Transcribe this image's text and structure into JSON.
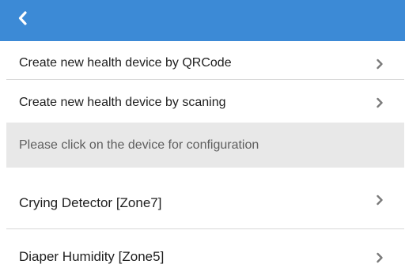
{
  "header": {
    "back_icon": "chevron-left-icon",
    "accent_color": "#3c8ad6"
  },
  "actions": [
    {
      "label": "Create new health device by QRCode",
      "icon": "chevron-right-icon"
    },
    {
      "label": "Create new health device by scaning",
      "icon": "chevron-right-icon"
    }
  ],
  "section": {
    "prompt": "Please click on the device for configuration",
    "background": "#e8e8e8"
  },
  "devices": [
    {
      "label": "Crying Detector [Zone7]",
      "icon": "chevron-right-icon"
    },
    {
      "label": "Diaper Humidity [Zone5]",
      "icon": "chevron-right-icon"
    }
  ]
}
